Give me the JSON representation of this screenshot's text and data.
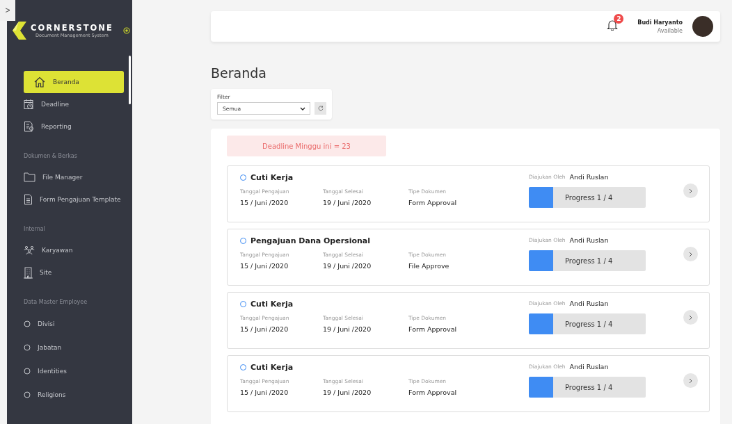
{
  "sidebar_toggle": {
    "label": ">"
  },
  "brand": {
    "name": "CORNERSTONE",
    "tagline": "Document Management System"
  },
  "sidebar": {
    "groups": [
      {
        "items": [
          {
            "label": "Beranda",
            "selected": true
          },
          {
            "label": "Deadline",
            "selected": false
          },
          {
            "label": "Reporting",
            "selected": false
          }
        ]
      },
      {
        "heading": "Dokumen & Berkas",
        "items": [
          {
            "label": "File Manager",
            "selected": false
          },
          {
            "label": "Form Pengajuan Template",
            "selected": false
          }
        ]
      },
      {
        "heading": "Internal",
        "items": [
          {
            "label": "Karyawan",
            "selected": false
          },
          {
            "label": "Site",
            "selected": false
          }
        ]
      },
      {
        "heading": "Data Master Employee",
        "items": [
          {
            "label": "Divisi",
            "selected": false
          },
          {
            "label": "Jabatan",
            "selected": false
          },
          {
            "label": "Identities",
            "selected": false
          },
          {
            "label": "Religions",
            "selected": false
          }
        ]
      }
    ]
  },
  "header": {
    "notification_count": "2",
    "user_name": "Budi Haryanto",
    "user_status": "Available"
  },
  "page_title": "Beranda",
  "filter": {
    "label": "Filter",
    "value": "Semua"
  },
  "deadline_banner": "Deadline Minggu ini = 23",
  "documents": [
    {
      "title": "Cuti Kerja",
      "submitted_label": "Tanggal Pengajuan",
      "submitted": "15 / Juni /2020",
      "finished_label": "Tanggal Selesai",
      "finished": "19 / Juni /2020",
      "type_label": "Tipe Dokumen",
      "type": "Form Approval",
      "by_label": "Diajukan Oleh",
      "by": "Andi Ruslan",
      "progress": "Progress 1 / 4",
      "level": 0.21
    },
    {
      "title": "Pengajuan Dana Opersional",
      "submitted_label": "Tanggal Pengajuan",
      "submitted": "15 / Juni /2020",
      "finished_label": "Tanggal Selesai",
      "finished": "19 / Juni /2020",
      "type_label": "Tipe Dokumen",
      "type": "File Approve",
      "by_label": "Diajukan Oleh",
      "by": "Andi Ruslan",
      "progress": "Progress 1 / 4",
      "level": 0.21
    },
    {
      "title": "Cuti Kerja",
      "submitted_label": "Tanggal Pengajuan",
      "submitted": "15 / Juni /2020",
      "finished_label": "Tanggal Selesai",
      "finished": "19 / Juni /2020",
      "type_label": "Tipe Dokumen",
      "type": "Form Approval",
      "by_label": "Diajukan Oleh",
      "by": "Andi Ruslan",
      "progress": "Progress 1 / 4",
      "level": 0.21
    },
    {
      "title": "Cuti Kerja",
      "submitted_label": "Tanggal Pengajuan",
      "submitted": "15 / Juni /2020",
      "finished_label": "Tanggal Selesai",
      "finished": "19 / Juni /2020",
      "type_label": "Tipe Dokumen",
      "type": "Form Approval",
      "by_label": "Diajukan Oleh",
      "by": "Andi Ruslan",
      "progress": "Progress 1 / 4",
      "level": 0.21
    }
  ]
}
